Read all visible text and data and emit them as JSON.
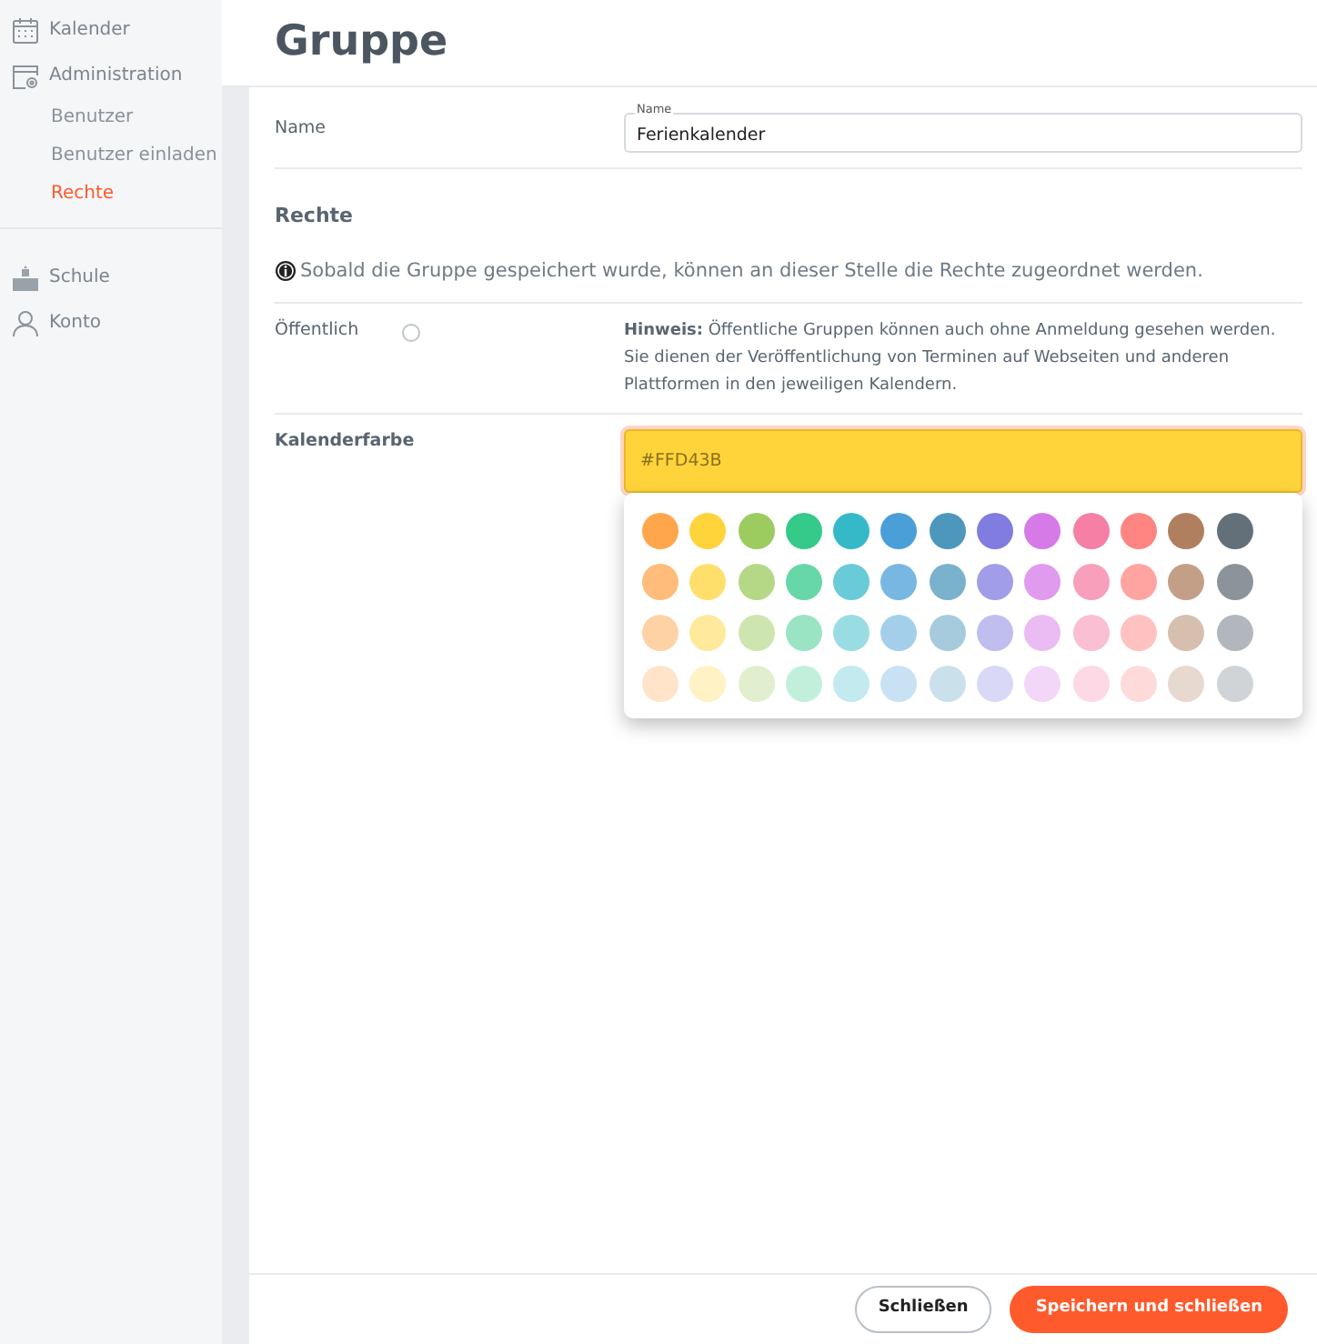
{
  "sidebar": {
    "items": [
      {
        "label": "Kalender",
        "kind": "calendar",
        "selected": false
      },
      {
        "label": "Administration",
        "kind": "admin",
        "selected": false,
        "children": [
          {
            "label": "Benutzer",
            "selected": false
          },
          {
            "label": "Benutzer einladen",
            "selected": false
          },
          {
            "label": "Rechte",
            "selected": true
          }
        ]
      }
    ],
    "items_2": [
      {
        "label": "Schule",
        "kind": "school",
        "selected": false
      },
      {
        "label": "Konto",
        "kind": "person",
        "selected": false
      }
    ]
  },
  "page": {
    "title": "Gruppe"
  },
  "form": {
    "name": {
      "label": "Name",
      "floating_label": "Name",
      "value": "Ferienkalender"
    },
    "rights": {
      "heading": "Rechte",
      "info": "Sobald die Gruppe gespeichert wurde, können an dieser Stelle die Rechte zugeordnet werden."
    },
    "public": {
      "label": "Öffentlich",
      "checked": false,
      "hint": "**Hinweis:** Öffentliche Gruppen können auch ohne Anmeldung gesehen werden. Sie dienen der Veröffentlichung von Terminen auf Webseiten und anderen Plattformen in den jeweiligen Kalendern."
    },
    "calendar_color": {
      "label": "Kalenderfarbe",
      "value": "#FFD43B",
      "color": "#ffd43b"
    },
    "palette": [
      [
        {
          "color": "#ffa64d"
        },
        {
          "color": "#ffd43b"
        },
        {
          "color": "#9ccb5f"
        },
        {
          "color": "#35c98a"
        },
        {
          "color": "#35b9c9"
        },
        {
          "color": "#4a9fd8"
        },
        {
          "color": "#4d97bc"
        },
        {
          "color": "#817ce0"
        },
        {
          "color": "#d67ae8"
        },
        {
          "color": "#f57fa5"
        },
        {
          "color": "#ff8582"
        },
        {
          "color": "#b07f60"
        },
        {
          "color": "#647079"
        }
      ],
      [
        {
          "color": "#ffbc7a"
        },
        {
          "color": "#ffdf6c"
        },
        {
          "color": "#b5d887"
        },
        {
          "color": "#68d7a7"
        },
        {
          "color": "#68cbd7"
        },
        {
          "color": "#77b7e2"
        },
        {
          "color": "#7ab1cd"
        },
        {
          "color": "#a19de8"
        },
        {
          "color": "#e09bee"
        },
        {
          "color": "#f89fbc"
        },
        {
          "color": "#ffa4a1"
        },
        {
          "color": "#c49f88"
        },
        {
          "color": "#8b949b"
        }
      ],
      [
        {
          "color": "#ffd2a6"
        },
        {
          "color": "#ffe99d"
        },
        {
          "color": "#cde5af"
        },
        {
          "color": "#9ae4c4"
        },
        {
          "color": "#9adce4"
        },
        {
          "color": "#a4cfeb"
        },
        {
          "color": "#a6cbdd"
        },
        {
          "color": "#c0bdef"
        },
        {
          "color": "#eabcf3"
        },
        {
          "color": "#fabfd2"
        },
        {
          "color": "#ffc2c0"
        },
        {
          "color": "#d7bfaf"
        },
        {
          "color": "#b1b7bc"
        }
      ],
      [
        {
          "color": "#ffe4ca"
        },
        {
          "color": "#fff2c4"
        },
        {
          "color": "#e1efcf"
        },
        {
          "color": "#c2efdc"
        },
        {
          "color": "#c2eaef"
        },
        {
          "color": "#c9e2f3"
        },
        {
          "color": "#cae0eb"
        },
        {
          "color": "#d9d8f6"
        },
        {
          "color": "#f3d7f8"
        },
        {
          "color": "#fcd9e4"
        },
        {
          "color": "#ffdada"
        },
        {
          "color": "#e7d9cf"
        },
        {
          "color": "#d1d4d7"
        }
      ]
    ]
  },
  "footer": {
    "buttons": [
      {
        "label": "Schließen",
        "kind": "secondary"
      },
      {
        "label": "Speichern und schließen",
        "kind": "primary"
      }
    ]
  }
}
